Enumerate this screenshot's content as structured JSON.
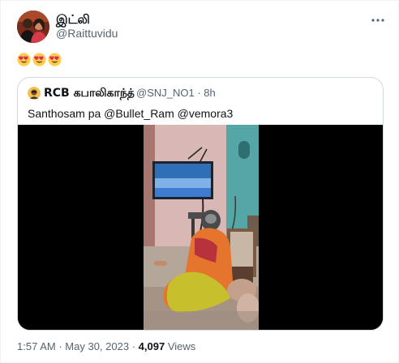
{
  "author": {
    "name": "இட்லி",
    "handle": "@Raittuvidu"
  },
  "tweet": {
    "emojis": [
      "smiling-face-with-heart-eyes-icon",
      "smiling-face-with-heart-eyes-icon",
      "smiling-face-with-heart-eyes-icon"
    ]
  },
  "quoted": {
    "name": "RCB கபாலிகாந்த்",
    "meta": "@SNJ_NO1 · 8h",
    "text": "Santhosam pa @Bullet_Ram @vemora3"
  },
  "footer": {
    "time": "1:57 AM",
    "sep1": "·",
    "date": "May 30, 2023",
    "sep2": "·",
    "views_count": "4,097",
    "views_label": "Views"
  }
}
